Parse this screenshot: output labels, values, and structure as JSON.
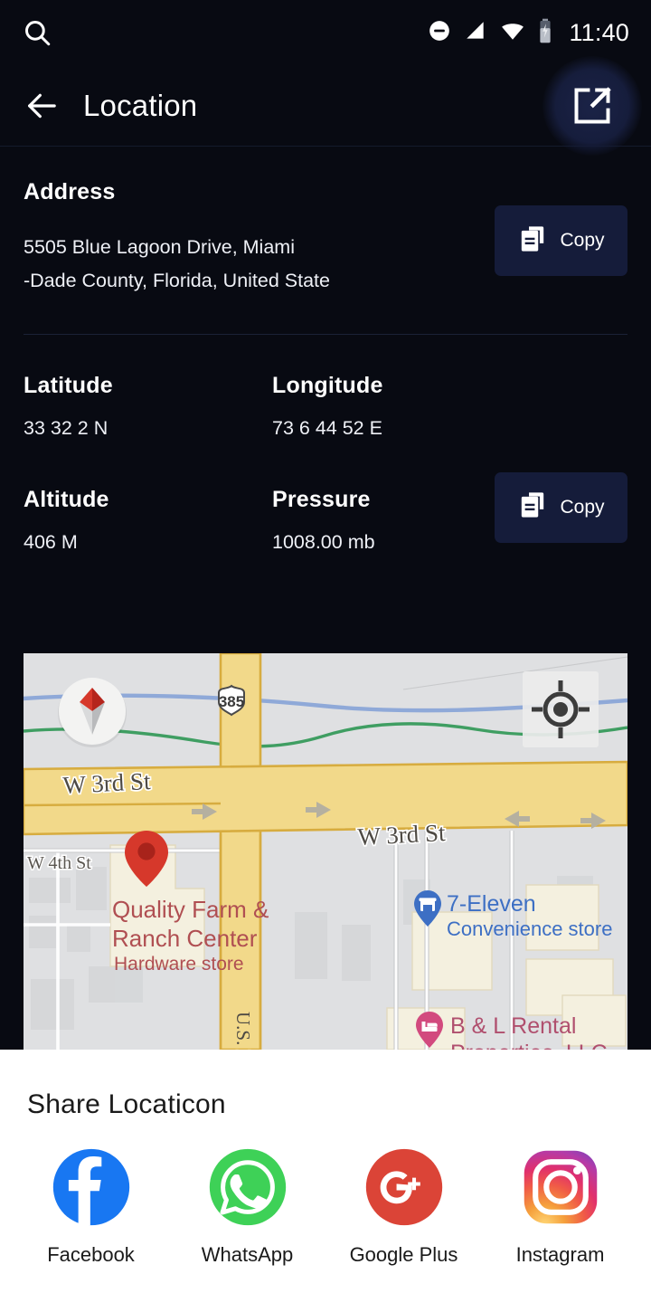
{
  "statusbar": {
    "search_icon": "search-icon",
    "dnd_icon": "do-not-disturb-icon",
    "signal_icon": "cellular-signal-icon",
    "wifi_icon": "wifi-icon",
    "battery_icon": "battery-charging-icon",
    "time": "11:40"
  },
  "appbar": {
    "back_icon": "arrow-left-icon",
    "title": "Location",
    "share_icon": "open-in-new-icon"
  },
  "address": {
    "label": "Address",
    "line1": "5505 Blue Lagoon Drive, Miami",
    "line2": "-Dade County, Florida, United State",
    "copy_label": "Copy",
    "copy_icon": "copy-icon"
  },
  "coordinates": {
    "latitude_label": "Latitude",
    "latitude_value": "33 32 2 N",
    "longitude_label": "Longitude",
    "longitude_value": "73 6 44 52 E",
    "altitude_label": "Altitude",
    "altitude_value": "406 M",
    "pressure_label": "Pressure",
    "pressure_value": "1008.00 mb",
    "copy_label": "Copy",
    "copy_icon": "copy-icon"
  },
  "map": {
    "compass_icon": "compass-icon",
    "my_location_icon": "my-location-icon",
    "marker_icon": "map-pin-icon",
    "highway_shield": "385",
    "labels": {
      "street_top": "W 3rd St",
      "street_right": "W 3rd St",
      "street_left": "W 4th St",
      "highway_vertical": "U.S. H",
      "poi1_name": "Quality Farm &",
      "poi1_name2": "Ranch Center",
      "poi1_type": "Hardware store",
      "poi2_name": "7-Eleven",
      "poi2_type": "Convenience store",
      "poi3_name": "B & L Rental",
      "poi3_name2": "Properties, LLC"
    },
    "colors": {
      "land": "#dfe0e2",
      "road_major": "#f2d98a",
      "road_outline": "#d7ac3f",
      "water": "#8fa9d8",
      "park_line": "#3f9e62",
      "marker_red": "#d6382b",
      "poi_blue": "#3d6fc4",
      "poi_red": "#b04f52",
      "poi_pink": "#d24a7e"
    }
  },
  "share_sheet": {
    "title": "Share  Locaticon",
    "items": [
      {
        "label": "Facebook",
        "icon": "facebook-icon",
        "color": "#1877F2"
      },
      {
        "label": "WhatsApp",
        "icon": "whatsapp-icon",
        "color": "#3ED157"
      },
      {
        "label": "Google Plus",
        "icon": "google-plus-icon",
        "color": "#DB4437"
      },
      {
        "label": "Instagram",
        "icon": "instagram-icon",
        "color": "#E1306C"
      }
    ]
  },
  "theme": {
    "background": "#080a12",
    "surface": "#151c3a",
    "text_primary": "#ffffff"
  }
}
